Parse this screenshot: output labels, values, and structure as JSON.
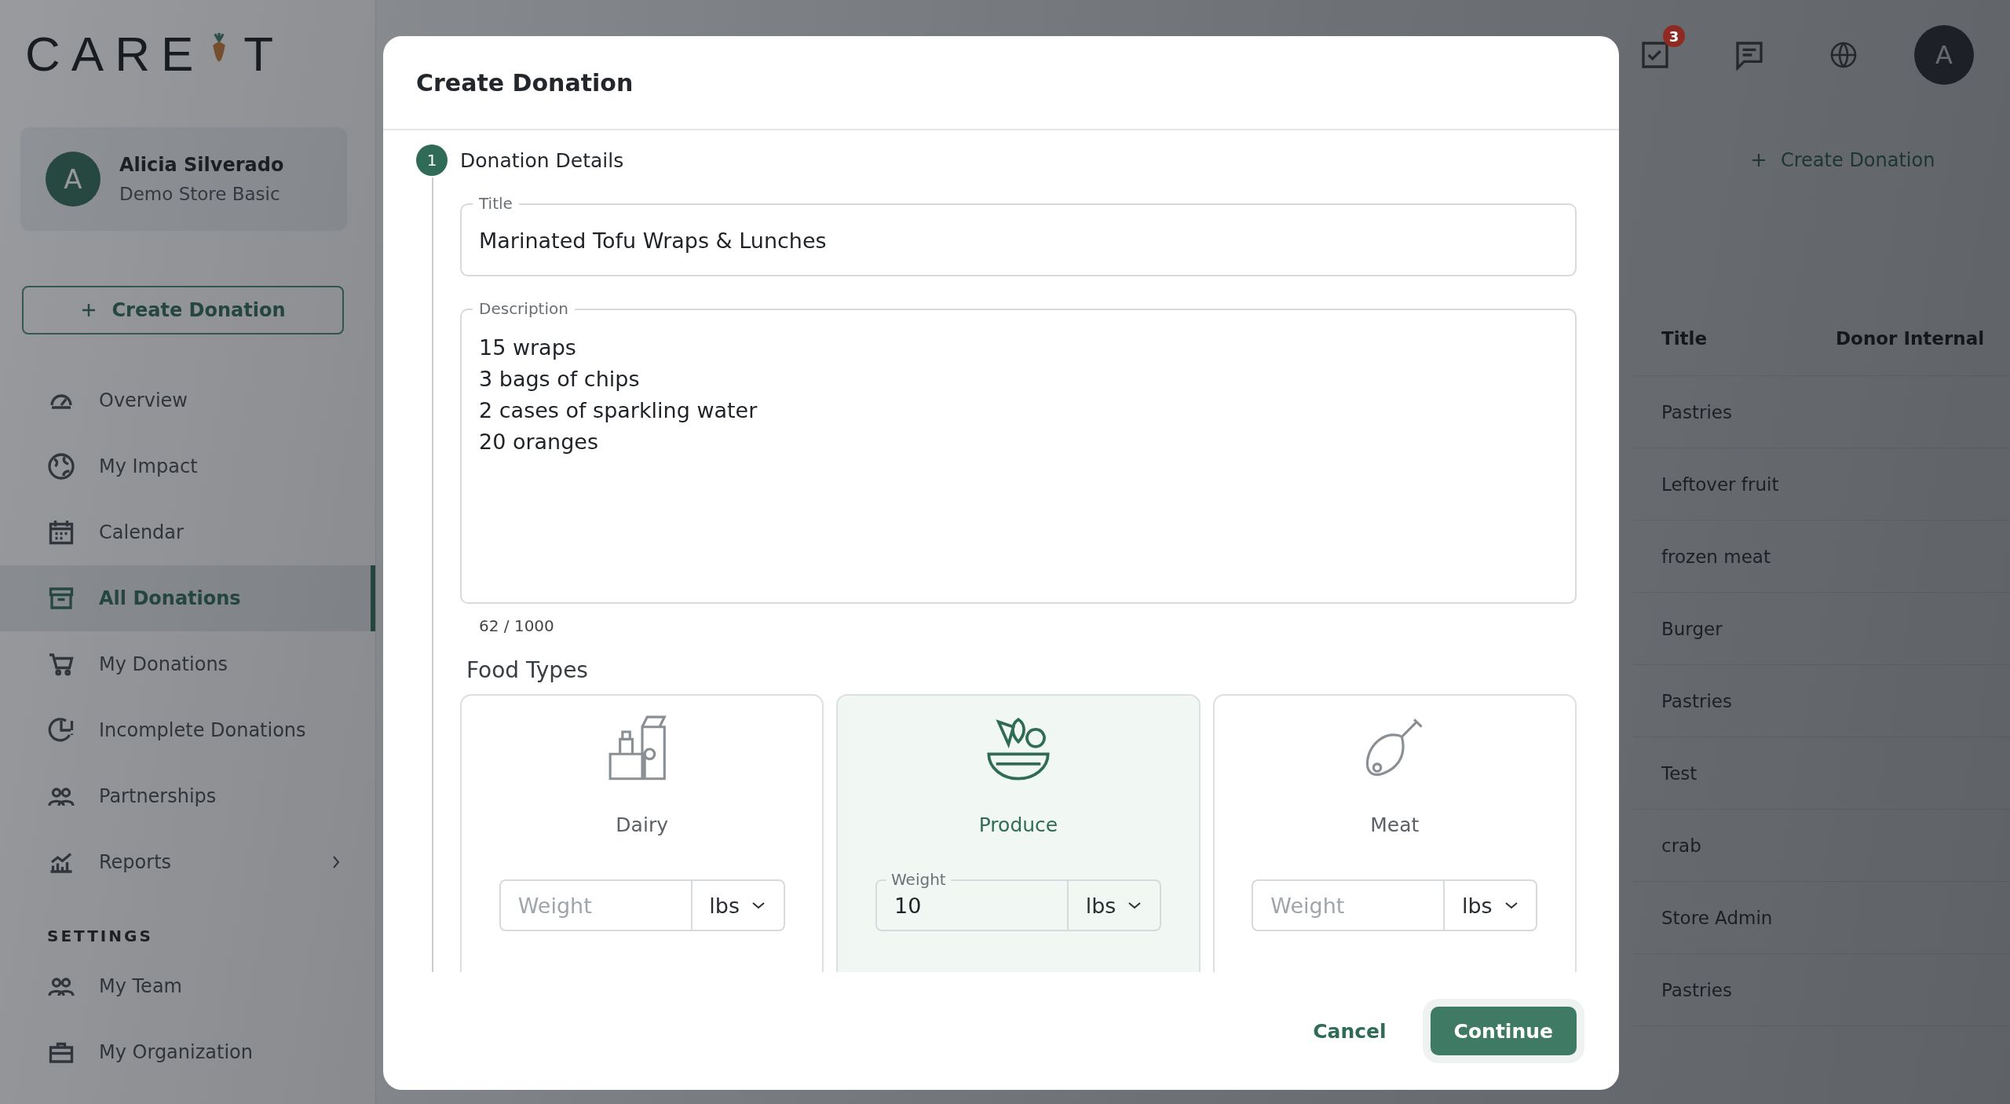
{
  "brand": {
    "left": "CARE",
    "right": "T"
  },
  "user": {
    "initial": "A",
    "name": "Alicia Silverado",
    "store": "Demo Store Basic"
  },
  "sidebar_button": {
    "label": "Create Donation"
  },
  "nav": [
    {
      "label": "Overview",
      "selected": false
    },
    {
      "label": "My Impact",
      "selected": false
    },
    {
      "label": "Calendar",
      "selected": false
    },
    {
      "label": "All Donations",
      "selected": true
    },
    {
      "label": "My Donations",
      "selected": false
    },
    {
      "label": "Incomplete Donations",
      "selected": false
    },
    {
      "label": "Partnerships",
      "selected": false
    },
    {
      "label": "Reports",
      "selected": false,
      "expandable": true
    }
  ],
  "settings": {
    "heading": "SETTINGS",
    "items": [
      {
        "label": "My Team",
        "selected": false
      },
      {
        "label": "My Organization",
        "selected": false
      }
    ]
  },
  "header": {
    "task_badge": "3",
    "avatar": "A"
  },
  "main": {
    "create_button": "Create Donation",
    "table": {
      "columns": [
        "Title",
        "Donor Internal"
      ],
      "rows": [
        "Pastries",
        "Leftover fruit",
        "frozen meat",
        "Burger",
        "Pastries",
        "Test",
        "crab",
        "Store Admin",
        "Pastries"
      ]
    }
  },
  "modal": {
    "title": "Create Donation",
    "step": {
      "number": "1",
      "label": "Donation Details"
    },
    "title_field": {
      "label": "Title",
      "value": "Marinated Tofu Wraps & Lunches"
    },
    "description_field": {
      "label": "Description",
      "value": "15 wraps\n3 bags of chips\n2 cases of sparkling water\n20 oranges"
    },
    "counter": "62 / 1000",
    "food_types_heading": "Food Types",
    "food_types": [
      {
        "label": "Dairy",
        "selected": false,
        "weight": {
          "placeholder": "Weight"
        },
        "unit": "lbs"
      },
      {
        "label": "Produce",
        "selected": true,
        "weight": {
          "label": "Weight",
          "value": "10"
        },
        "unit": "lbs"
      },
      {
        "label": "Meat",
        "selected": false,
        "weight": {
          "placeholder": "Weight"
        },
        "unit": "lbs"
      }
    ],
    "cancel": "Cancel",
    "continue": "Continue"
  }
}
